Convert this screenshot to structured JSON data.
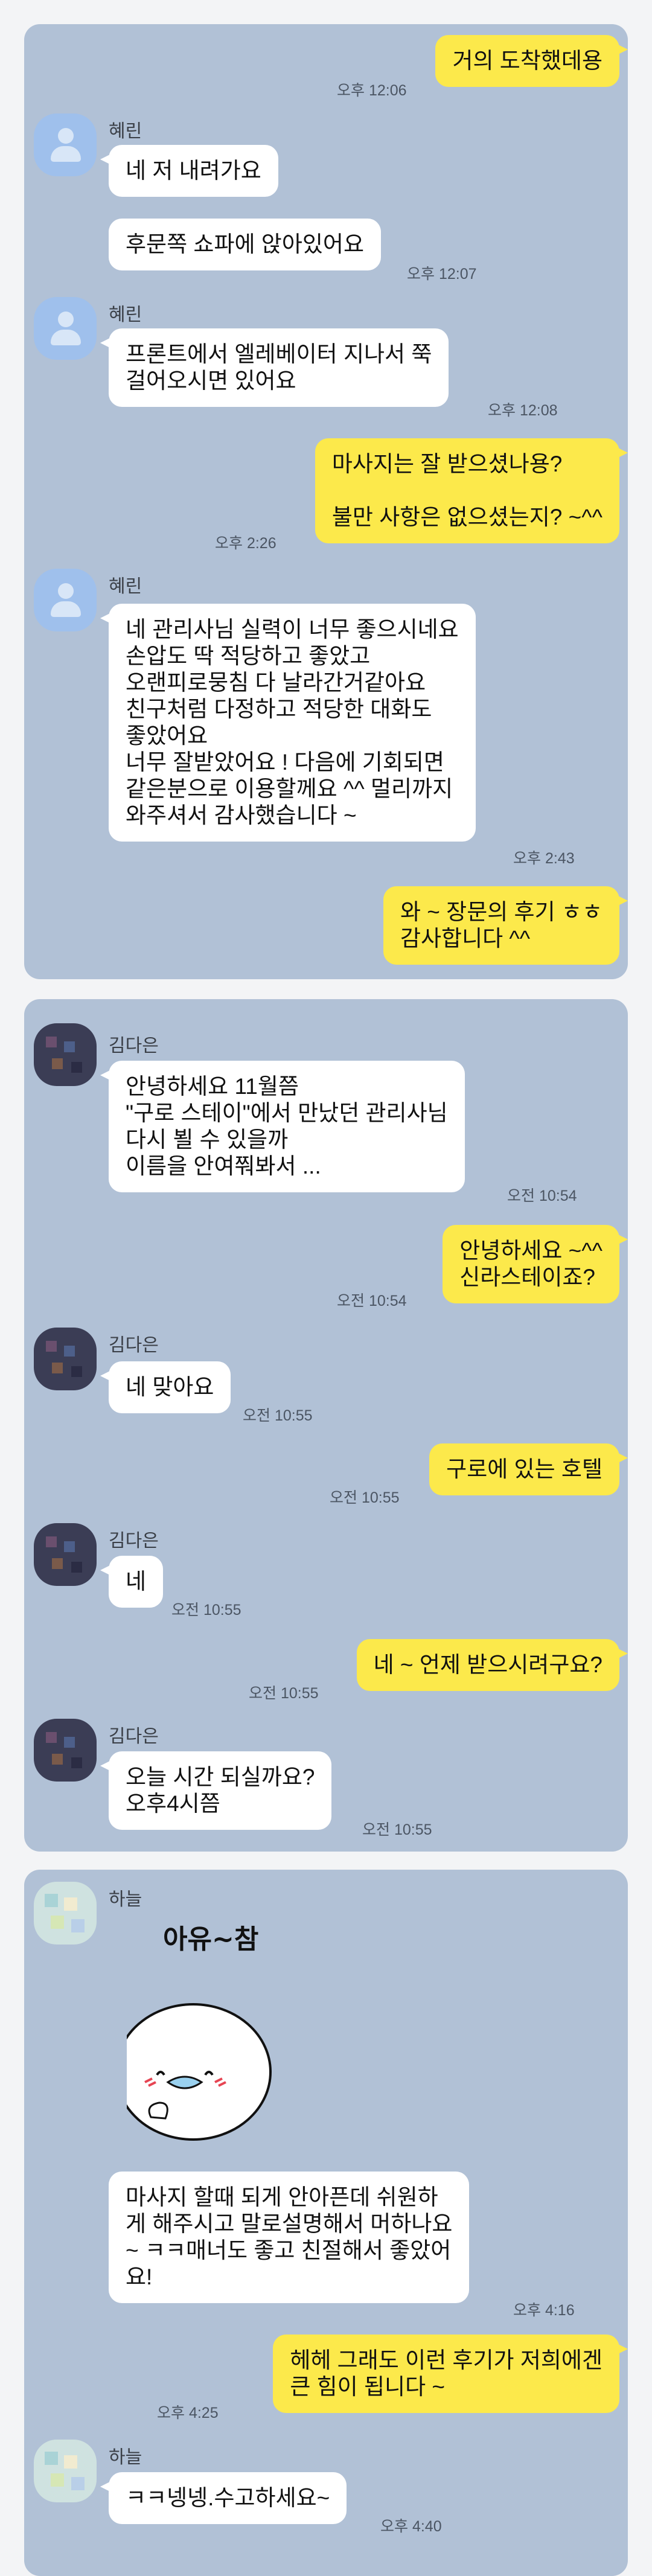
{
  "panel1": {
    "m1": {
      "text": "거의 도착했데용",
      "time": "오후 12:06"
    },
    "sender": "혜린",
    "m2": {
      "text": "네 저 내려가요"
    },
    "m3": {
      "text": "후문쪽 쇼파에 앉아있어요",
      "time": "오후 12:07"
    },
    "m4": {
      "text": "프론트에서 엘레베이터 지나서 쭉\n걸어오시면 있어요",
      "time": "오후 12:08"
    },
    "m5": {
      "text": "마사지는 잘 받으셨나용?\n\n불만 사항은 없으셨는지? ~^^",
      "time": "오후 2:26"
    },
    "m6": {
      "text": "네 관리사님 실력이 너무 좋으시네요\n손압도 딱 적당하고 좋았고\n오랜피로뭉침 다 날라간거같아요\n친구처럼 다정하고 적당한 대화도\n좋았어요\n너무 잘받았어요 ! 다음에 기회되면\n같은분으로 이용할께요 ^^ 멀리까지\n와주셔서 감사했습니다 ~",
      "time": "오후 2:43"
    },
    "m7": {
      "text": "와 ~ 장문의 후기 ㅎㅎ\n감사합니다 ^^"
    }
  },
  "panel2": {
    "sender": "김다은",
    "m1": {
      "text": "안녕하세요 11월쯤\n\"구로 스테이\"에서 만났던 관리사님\n다시 뵐 수 있을까\n이름을 안여쭤봐서 ...",
      "time": "오전 10:54"
    },
    "m2": {
      "text": "안녕하세요 ~^^\n신라스테이죠?",
      "time": "오전 10:54"
    },
    "m3": {
      "text": "네 맞아요",
      "time": "오전 10:55"
    },
    "m4": {
      "text": "구로에 있는 호텔",
      "time": "오전 10:55"
    },
    "m5": {
      "text": "네",
      "time": "오전 10:55"
    },
    "m6": {
      "text": "네 ~ 언제 받으시려구요?",
      "time": "오전 10:55"
    },
    "m7": {
      "text": "오늘  시간 되실까요?\n오후4시쯤",
      "time": "오전 10:55"
    }
  },
  "panel3": {
    "sender": "하늘",
    "sticker_text": "아유~참",
    "m1": {
      "text": "마사지 할때 되게 안아픈데 쉬원하\n게 해주시고 말로설명해서 머하나요\n~ ㅋㅋ매너도 좋고 친절해서 좋았어\n요!",
      "time": "오후 4:16"
    },
    "m2": {
      "text": "헤헤 그래도 이런 후기가 저희에겐\n큰 힘이 됩니다 ~",
      "time": "오후 4:25"
    },
    "m3": {
      "text": "ㅋㅋ넹넹.수고하세요~",
      "time": "오후 4:40"
    }
  }
}
